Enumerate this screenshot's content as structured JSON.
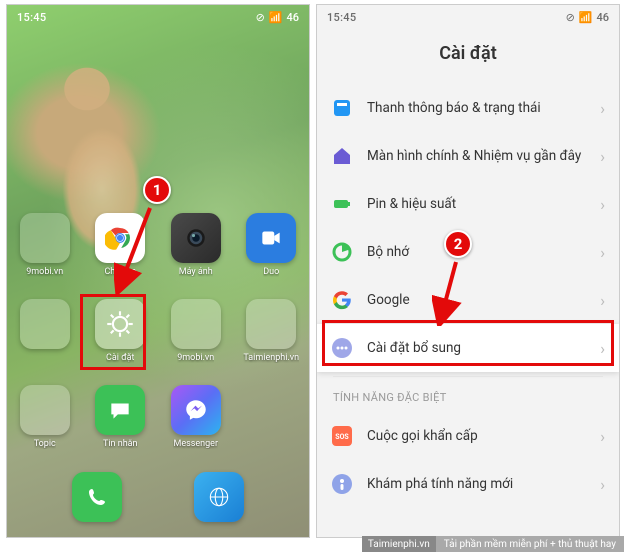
{
  "statusbar": {
    "time": "15:45",
    "battery": "46"
  },
  "home": {
    "apps": [
      {
        "name": "9mobi.vn"
      },
      {
        "name": "Chrome"
      },
      {
        "name": "Máy ảnh"
      },
      {
        "name": "Duo"
      },
      {
        "name": ""
      },
      {
        "name": "Cài đặt"
      },
      {
        "name": "9mobi.vn"
      },
      {
        "name": "Taimienphi.vn"
      },
      {
        "name": "Topic"
      },
      {
        "name": "Tin nhắn"
      },
      {
        "name": "Messenger"
      }
    ]
  },
  "settings": {
    "title": "Cài đặt",
    "rows": [
      {
        "label": "Thanh thông báo & trạng thái"
      },
      {
        "label": "Màn hình chính & Nhiệm vụ gần đây"
      },
      {
        "label": "Pin & hiệu suất"
      },
      {
        "label": "Bộ nhớ"
      },
      {
        "label": "Google"
      },
      {
        "label": "Cài đặt bổ sung"
      }
    ],
    "section_special": "TÍNH NĂNG ĐẶC BIỆT",
    "special_rows": [
      {
        "label": "Cuộc gọi khẩn cấp"
      },
      {
        "label": "Khám phá tính năng mới"
      }
    ]
  },
  "annotations": {
    "step1": "1",
    "step2": "2"
  },
  "footer": {
    "brand": "Taimienphi.vn",
    "slogan": "Tải phần mềm miễn phí + thủ thuật hay"
  }
}
